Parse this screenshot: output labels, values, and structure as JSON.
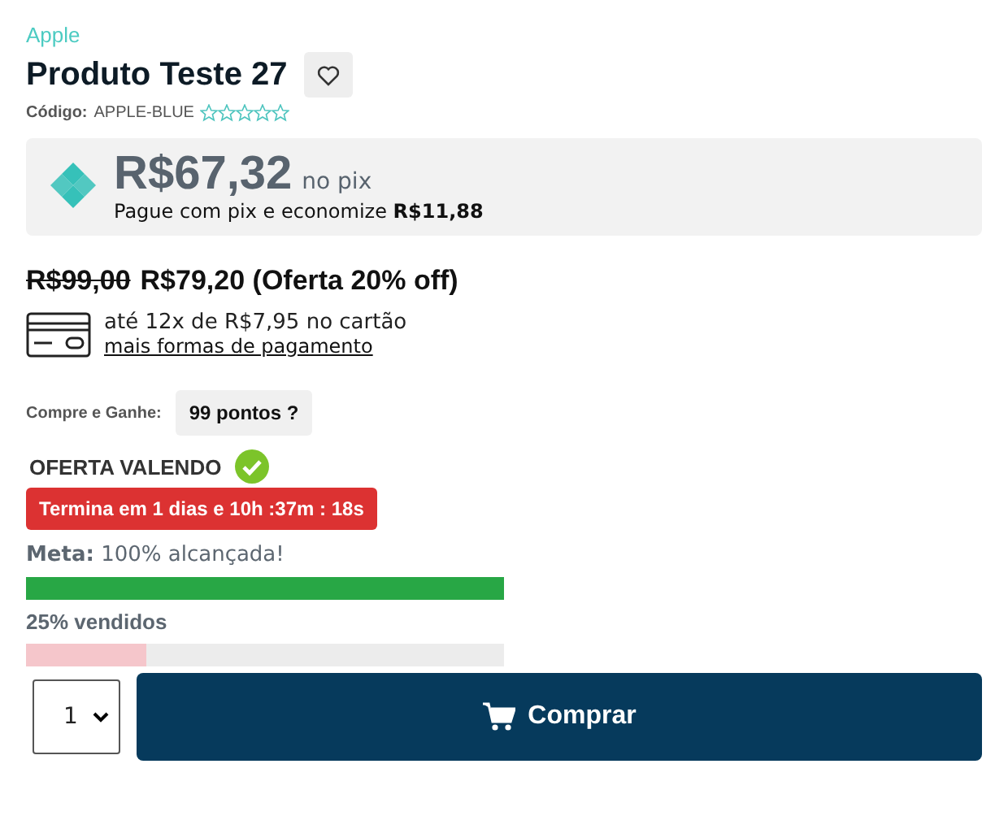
{
  "brand": "Apple",
  "product": {
    "title": "Produto Teste 27",
    "code_label": "Código:",
    "code": "APPLE-BLUE",
    "stars": 0
  },
  "pix": {
    "price": "R$67,32",
    "suffix": "no pix",
    "note": "Pague com pix e economize **R$11,88**"
  },
  "price": {
    "old": "R$99,00",
    "new": "R$79,20 (Oferta 20% off)"
  },
  "installments": {
    "text": "até 12x de R$7,95 no cartão",
    "link": "mais formas de pagamento"
  },
  "points": {
    "label": "Compre e Ganhe:",
    "value": "99 pontos ?"
  },
  "offer": {
    "title": "OFERTA VALENDO",
    "active": true,
    "countdown": "Termina em 1 dias e 10h :37m : 18s"
  },
  "goal": {
    "text": "**Meta:** 100% alcançada!",
    "level": 1
  },
  "sold": {
    "text": "25% vendidos",
    "level": 0.25
  },
  "quantity": {
    "value": "1"
  },
  "buy_button": "Comprar"
}
